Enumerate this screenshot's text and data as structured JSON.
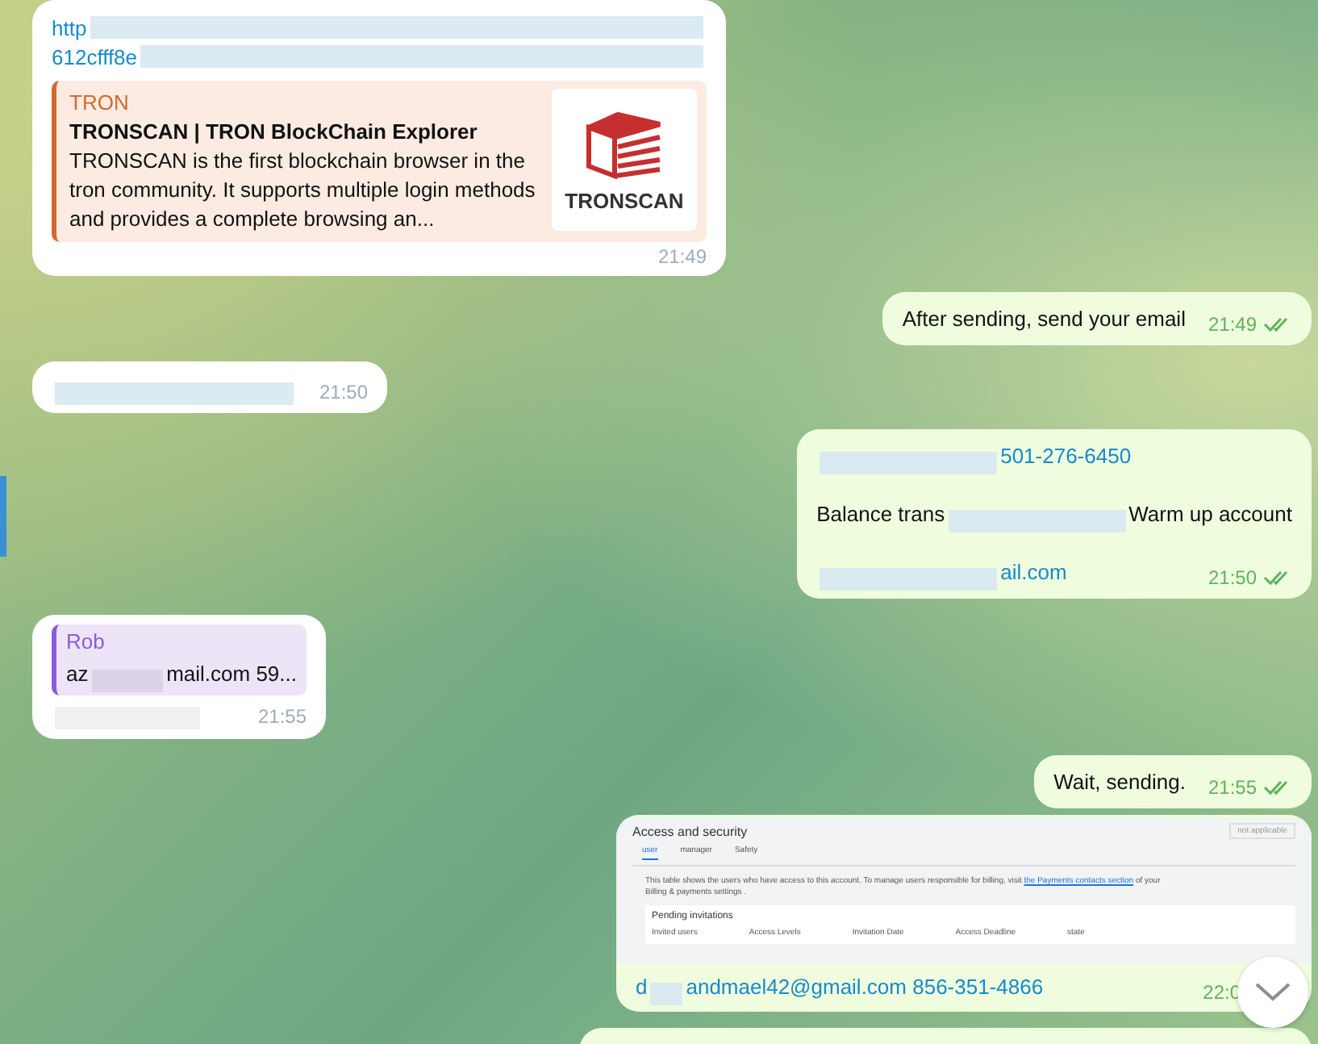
{
  "messages": [
    {
      "kind": "link_preview",
      "outgoing": false,
      "link_lines": [
        "http",
        "612cfff8e"
      ],
      "preview": {
        "site": "TRON",
        "title": "TRONSCAN | TRON BlockChain Explorer",
        "description": "TRONSCAN is the first blockchain browser in the tron community. It supports multiple login methods and provides a complete browsing an...",
        "logo_text": "TRONSCAN"
      },
      "time": "21:49"
    },
    {
      "kind": "text",
      "outgoing": true,
      "lines": [
        [
          {
            "kind": "text",
            "text": "After sending, send your email"
          }
        ]
      ],
      "time": "21:49",
      "read": true
    },
    {
      "kind": "text",
      "outgoing": false,
      "lines": [
        [
          {
            "kind": "blur"
          }
        ]
      ],
      "time": "21:50"
    },
    {
      "kind": "text",
      "outgoing": true,
      "lines": [
        [
          {
            "kind": "blur"
          },
          {
            "kind": "link",
            "text": "501-276-6450"
          }
        ],
        [
          {
            "kind": "text",
            "text": "Balance trans"
          },
          {
            "kind": "blur"
          },
          {
            "kind": "text",
            "text": "Warm up account"
          }
        ],
        [
          {
            "kind": "blur"
          },
          {
            "kind": "link",
            "text": "ail.com"
          }
        ]
      ],
      "time": "21:50",
      "read": true
    },
    {
      "kind": "reply",
      "outgoing": false,
      "quote": {
        "name": "Rob",
        "parts": [
          {
            "kind": "text",
            "text": "az"
          },
          {
            "kind": "blur"
          },
          {
            "kind": "text",
            "text": "mail.com 59..."
          }
        ]
      },
      "lines": [
        [
          {
            "kind": "blur"
          }
        ]
      ],
      "time": "21:55"
    },
    {
      "kind": "text",
      "outgoing": true,
      "lines": [
        [
          {
            "kind": "text",
            "text": "Wait, sending."
          }
        ]
      ],
      "time": "21:55",
      "read": true
    },
    {
      "kind": "image",
      "outgoing": true,
      "screenshot": {
        "title": "Access and security",
        "button": "not applicable",
        "tabs": [
          {
            "label": "user",
            "selected": true
          },
          {
            "label": "manager",
            "selected": false
          },
          {
            "label": "Safety",
            "selected": false
          }
        ],
        "description": "This table shows the users who have access to this account. To manage users responsible for billing, visit",
        "link": "the Payments contacts section",
        "description_end": "of your Billing & payments settings .",
        "section_title": "Pending invitations",
        "columns": [
          "Invited users",
          "Access Levels",
          "Invitation Date",
          "Access Deadline",
          "state"
        ]
      },
      "lines": [
        [
          {
            "kind": "link",
            "text": "d"
          },
          {
            "kind": "blur"
          },
          {
            "kind": "link",
            "text": "andmael42@gmail.com 856-351-4866"
          }
        ]
      ],
      "time": "22:0"
    },
    {
      "kind": "partial",
      "outgoing": true
    }
  ]
}
